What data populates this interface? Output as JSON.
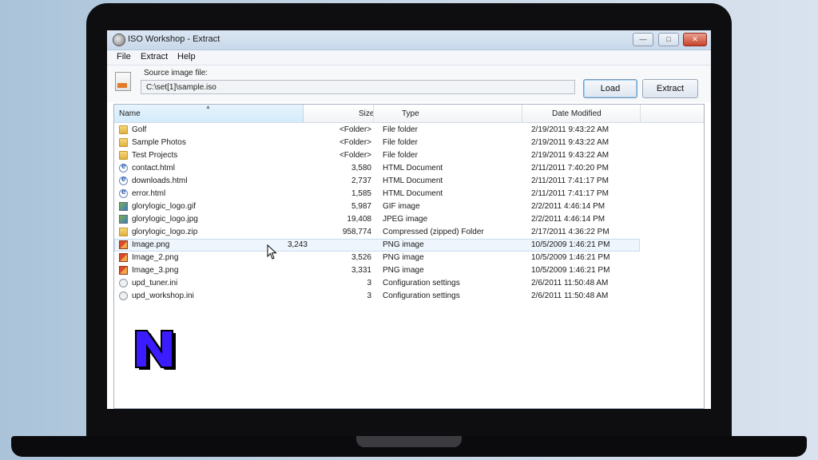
{
  "window": {
    "title": "ISO Workshop - Extract",
    "controls": {
      "minimize": "—",
      "maximize": "□",
      "close": "✕"
    }
  },
  "menu": [
    "File",
    "Extract",
    "Help"
  ],
  "source": {
    "label": "Source image file:",
    "value": "C:\\set[1]\\sample.iso",
    "load_label": "Load",
    "extract_label": "Extract"
  },
  "columns": {
    "name": "Name",
    "size": "Size",
    "type": "Type",
    "date": "Date Modified"
  },
  "files": [
    {
      "name": "Golf",
      "size": "<Folder>",
      "type": "File folder",
      "date": "2/19/2011 9:43:22 AM",
      "icon": "folder-icon"
    },
    {
      "name": "Sample Photos",
      "size": "<Folder>",
      "type": "File folder",
      "date": "2/19/2011 9:43:22 AM",
      "icon": "folder-icon"
    },
    {
      "name": "Test Projects",
      "size": "<Folder>",
      "type": "File folder",
      "date": "2/19/2011 9:43:22 AM",
      "icon": "folder-icon"
    },
    {
      "name": "contact.html",
      "size": "3,580",
      "type": "HTML Document",
      "date": "2/11/2011 7:40:20 PM",
      "icon": "html-file-icon"
    },
    {
      "name": "downloads.html",
      "size": "2,737",
      "type": "HTML Document",
      "date": "2/11/2011 7:41:17 PM",
      "icon": "html-file-icon"
    },
    {
      "name": "error.html",
      "size": "1,585",
      "type": "HTML Document",
      "date": "2/11/2011 7:41:17 PM",
      "icon": "html-file-icon"
    },
    {
      "name": "glorylogic_logo.gif",
      "size": "5,987",
      "type": "GIF image",
      "date": "2/2/2011 4:46:14 PM",
      "icon": "image-file-icon"
    },
    {
      "name": "glorylogic_logo.jpg",
      "size": "19,408",
      "type": "JPEG image",
      "date": "2/2/2011 4:46:14 PM",
      "icon": "image-file-icon"
    },
    {
      "name": "glorylogic_logo.zip",
      "size": "958,774",
      "type": "Compressed (zipped) Folder",
      "date": "2/17/2011 4:36:22 PM",
      "icon": "zip-file-icon"
    },
    {
      "name": "Image.png",
      "size": "3,243",
      "type": "PNG image",
      "date": "10/5/2009 1:46:21 PM",
      "icon": "png-file-icon",
      "selected": true
    },
    {
      "name": "Image_2.png",
      "size": "3,526",
      "type": "PNG image",
      "date": "10/5/2009 1:46:21 PM",
      "icon": "png-file-icon"
    },
    {
      "name": "Image_3.png",
      "size": "3,331",
      "type": "PNG image",
      "date": "10/5/2009 1:46:21 PM",
      "icon": "png-file-icon"
    },
    {
      "name": "upd_tuner.ini",
      "size": "3",
      "type": "Configuration settings",
      "date": "2/6/2011 11:50:48 AM",
      "icon": "ini-file-icon"
    },
    {
      "name": "upd_workshop.ini",
      "size": "3",
      "type": "Configuration settings",
      "date": "2/6/2011 11:50:48 AM",
      "icon": "ini-file-icon"
    }
  ],
  "colors": {
    "accent": "#3d7fd6",
    "logo_fill": "#3a1cff",
    "logo_outline": "#000000"
  }
}
